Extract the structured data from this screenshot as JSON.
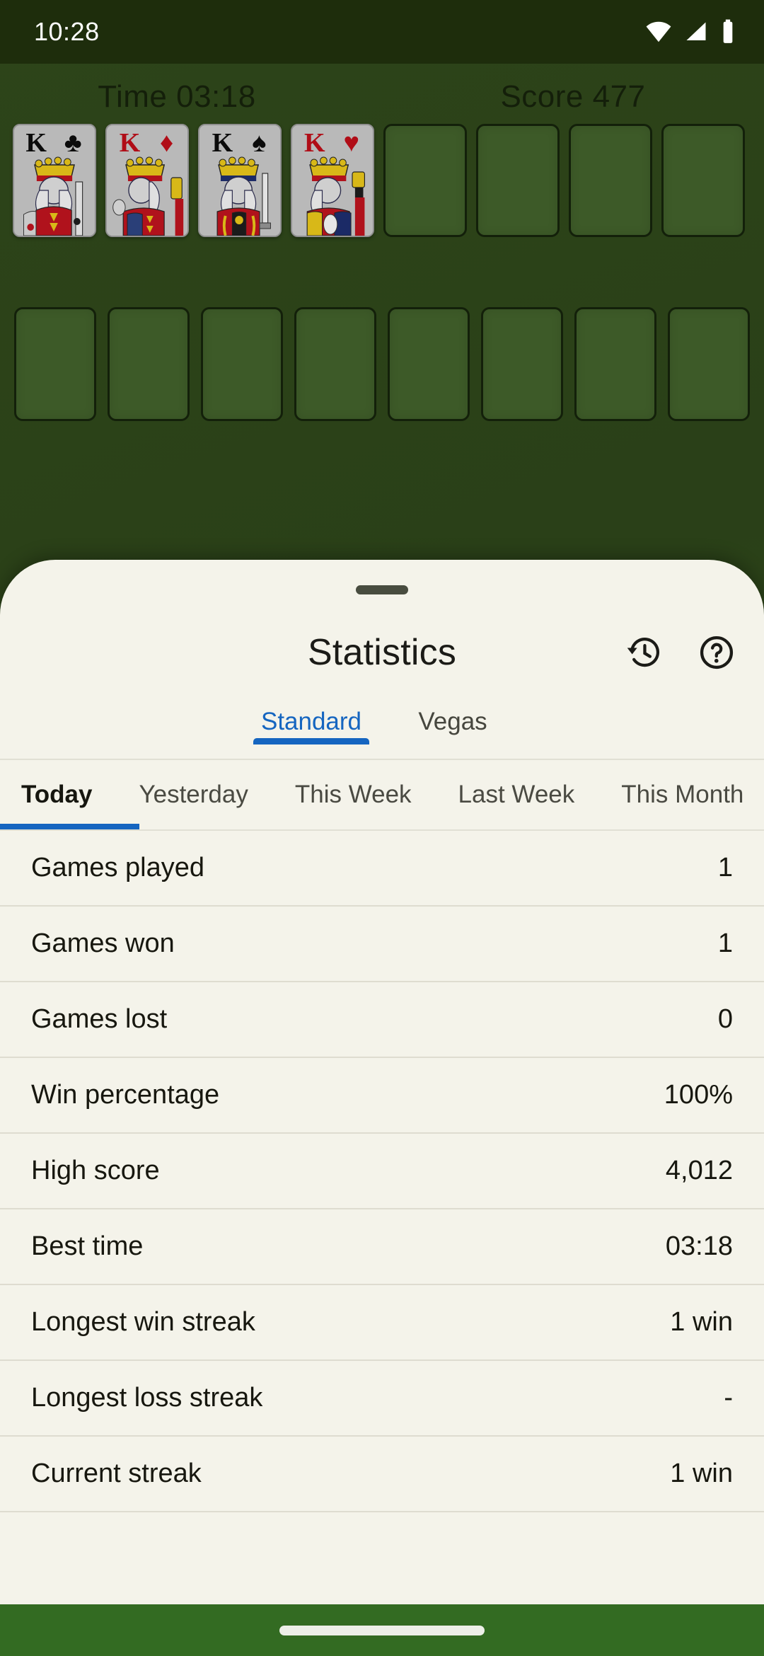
{
  "status_bar": {
    "time": "10:28",
    "icons": [
      "wifi-icon",
      "cell-signal-icon",
      "battery-icon"
    ]
  },
  "game": {
    "time_label": "Time 03:18",
    "score_label": "Score 477",
    "foundation_cards": [
      {
        "rank": "K",
        "suit": "♣",
        "color": "black"
      },
      {
        "rank": "K",
        "suit": "♦",
        "color": "red"
      },
      {
        "rank": "K",
        "suit": "♠",
        "color": "black"
      },
      {
        "rank": "K",
        "suit": "♥",
        "color": "red"
      }
    ],
    "free_cell_slots": 4,
    "tableau_slots": 8
  },
  "sheet": {
    "title": "Statistics",
    "actions": [
      {
        "name": "history-icon",
        "label": "History"
      },
      {
        "name": "help-icon",
        "label": "Help"
      }
    ],
    "mode_tabs": [
      {
        "label": "Standard",
        "active": true
      },
      {
        "label": "Vegas",
        "active": false
      }
    ],
    "period_tabs": [
      {
        "label": "Today",
        "active": true
      },
      {
        "label": "Yesterday",
        "active": false
      },
      {
        "label": "This Week",
        "active": false
      },
      {
        "label": "Last Week",
        "active": false
      },
      {
        "label": "This Month",
        "active": false
      }
    ],
    "stats": [
      {
        "label": "Games played",
        "value": "1"
      },
      {
        "label": "Games won",
        "value": "1"
      },
      {
        "label": "Games lost",
        "value": "0"
      },
      {
        "label": "Win percentage",
        "value": "100%"
      },
      {
        "label": "High score",
        "value": "4,012"
      },
      {
        "label": "Best time",
        "value": "03:18"
      },
      {
        "label": "Longest win streak",
        "value": "1 win"
      },
      {
        "label": "Longest loss streak",
        "value": "-"
      },
      {
        "label": "Current streak",
        "value": "1 win"
      }
    ]
  },
  "nav_bar": {
    "handle": "home-gesture-pill"
  },
  "colors": {
    "accent_blue": "#1565C0",
    "sheet_bg": "#F4F3EA",
    "board_bg": "#2a4018",
    "status_bg": "#1e2d0c",
    "nav_bg": "#336b22",
    "card_slot": "#3d5a28",
    "divider": "#dedcd0"
  }
}
